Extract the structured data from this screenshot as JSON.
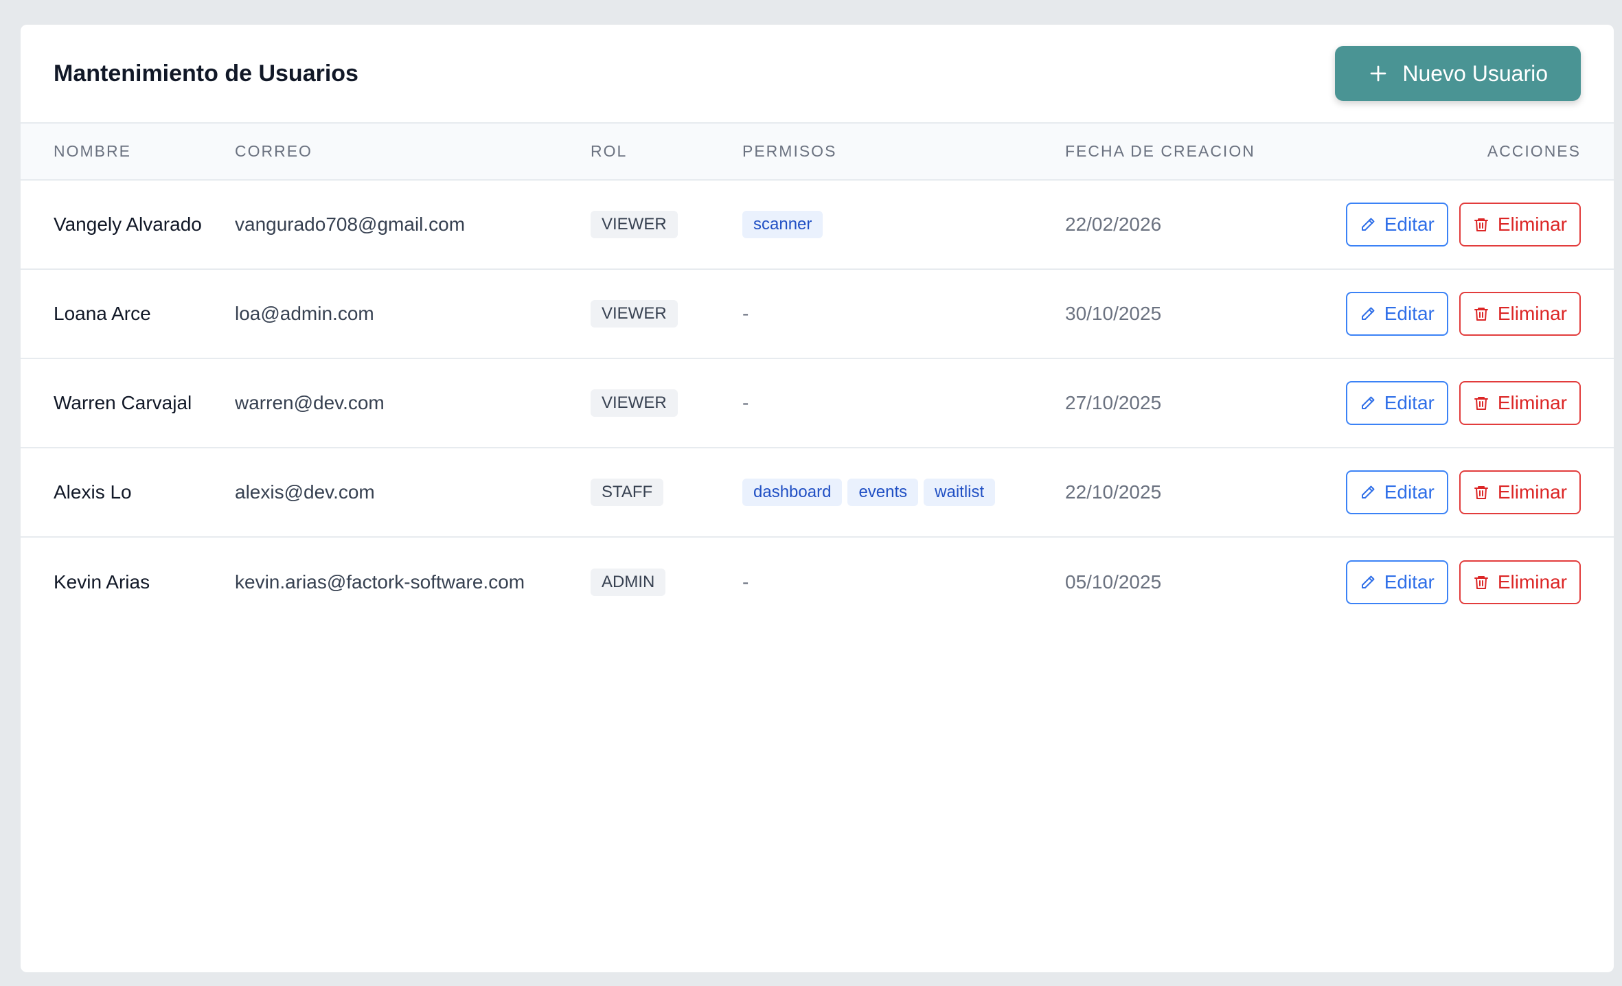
{
  "header": {
    "title": "Mantenimiento de Usuarios",
    "new_button_label": "Nuevo Usuario"
  },
  "table": {
    "columns": [
      "NOMBRE",
      "CORREO",
      "ROL",
      "PERMISOS",
      "FECHA DE CREACION",
      "ACCIONES"
    ],
    "edit_label": "Editar",
    "delete_label": "Eliminar",
    "empty_permissions": "-",
    "rows": [
      {
        "name": "Vangely Alvarado",
        "email": "vangurado708@gmail.com",
        "role": "VIEWER",
        "permissions": [
          "scanner"
        ],
        "date": "22/02/2026"
      },
      {
        "name": "Loana Arce",
        "email": "loa@admin.com",
        "role": "VIEWER",
        "permissions": [],
        "date": "30/10/2025"
      },
      {
        "name": "Warren Carvajal",
        "email": "warren@dev.com",
        "role": "VIEWER",
        "permissions": [],
        "date": "27/10/2025"
      },
      {
        "name": "Alexis Lo",
        "email": "alexis@dev.com",
        "role": "STAFF",
        "permissions": [
          "dashboard",
          "events",
          "waitlist"
        ],
        "date": "22/10/2025"
      },
      {
        "name": "Kevin Arias",
        "email": "kevin.arias@factork-software.com",
        "role": "ADMIN",
        "permissions": [],
        "date": "05/10/2025"
      }
    ]
  },
  "colors": {
    "primary": "#4a9494",
    "edit": "#2f6fe8",
    "delete": "#dc2626",
    "background": "#e6e9ec"
  },
  "icons": {
    "new_button": "plus-icon",
    "edit": "pencil-icon",
    "delete": "trash-icon"
  }
}
